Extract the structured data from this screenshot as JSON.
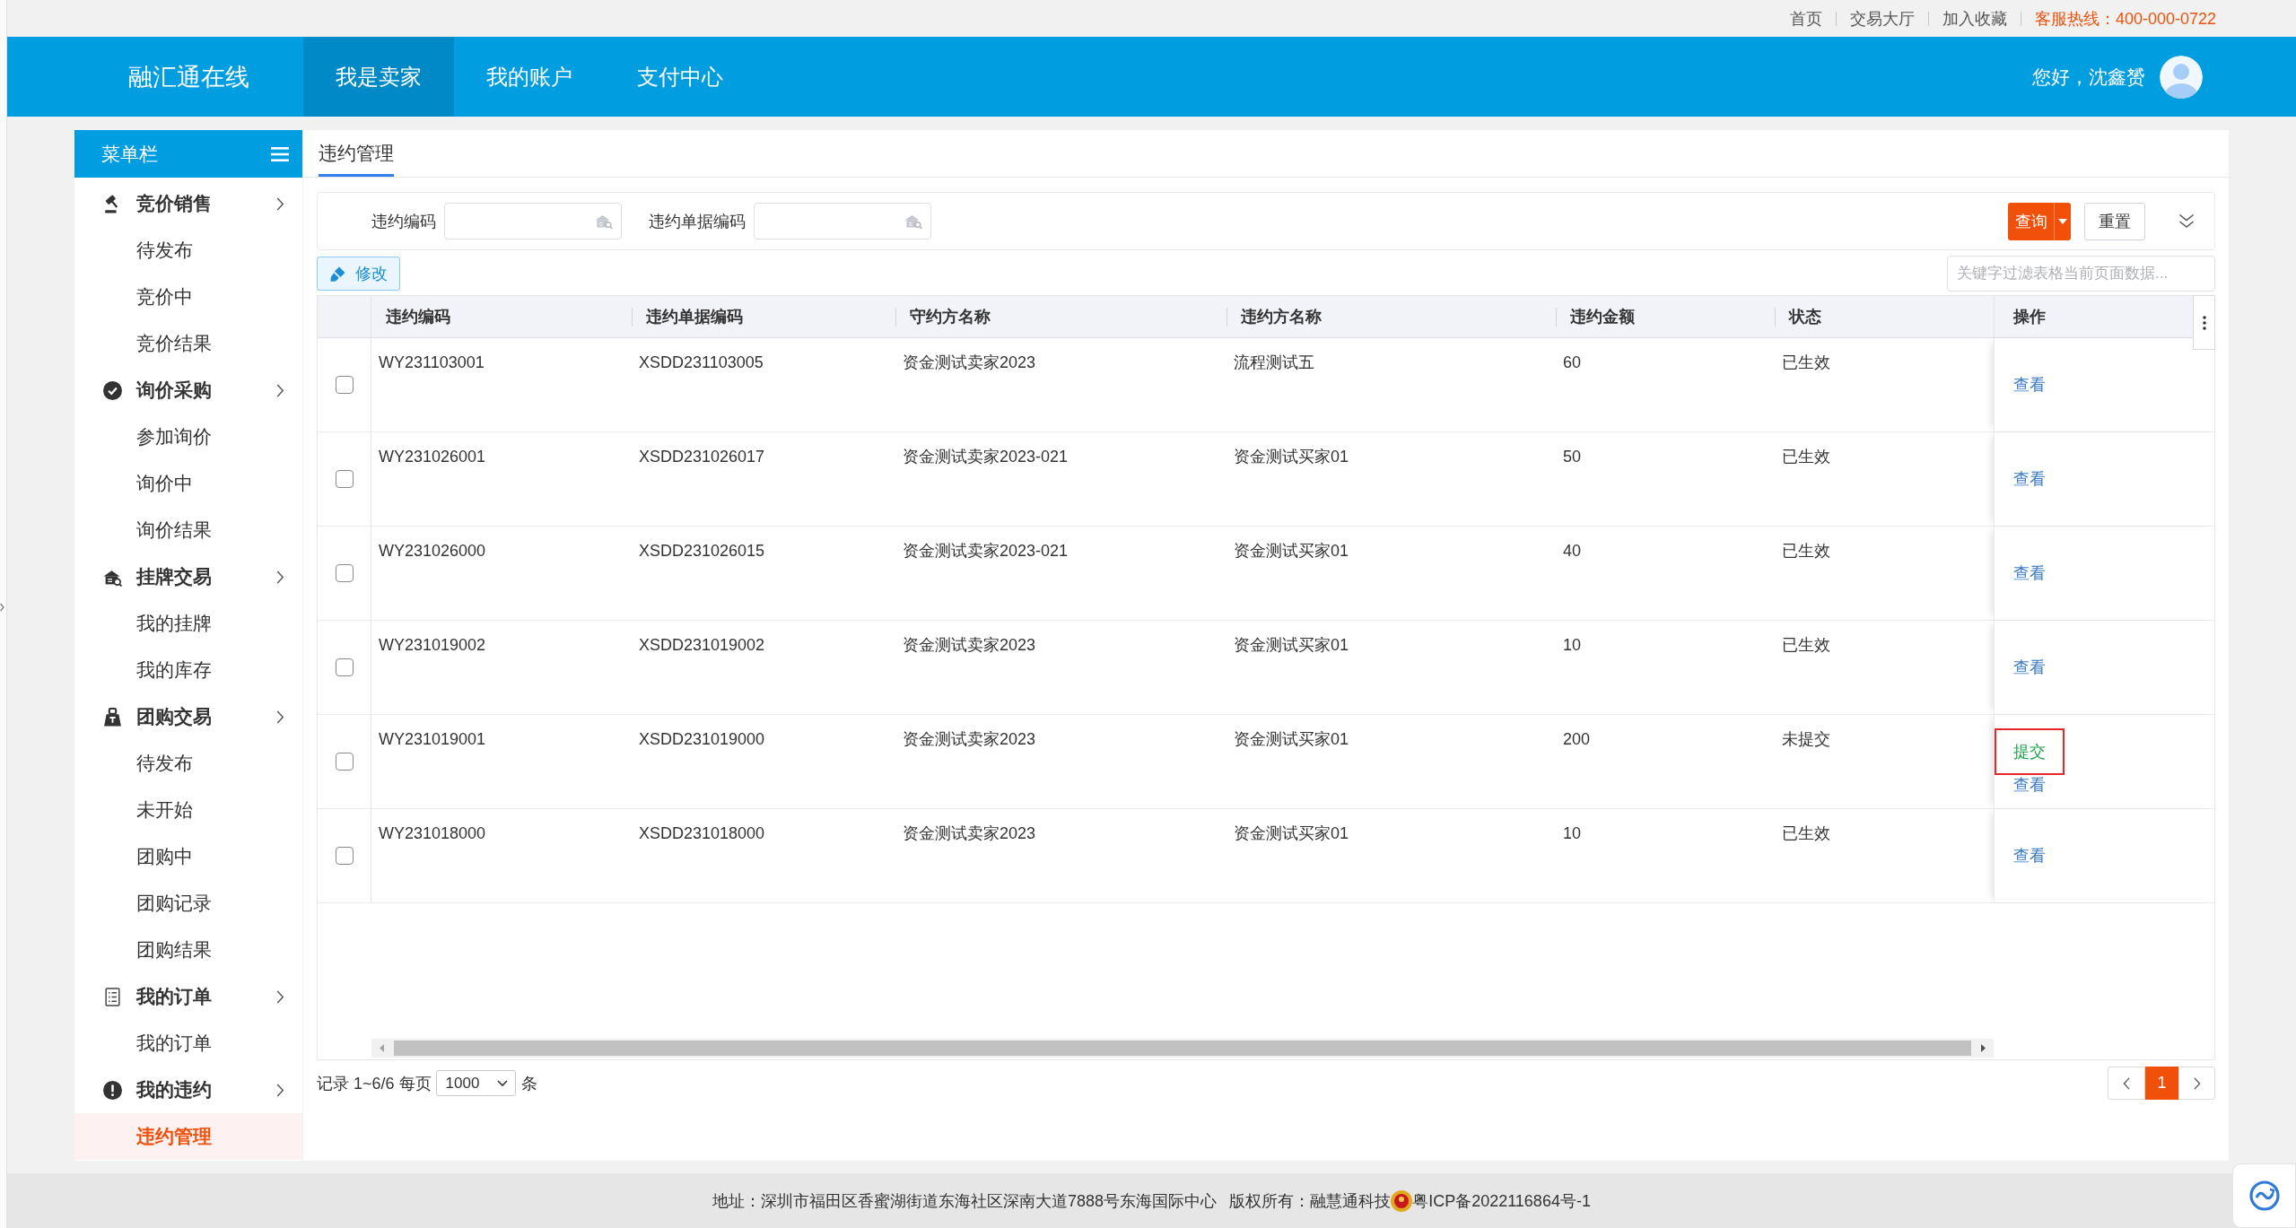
{
  "top_bar": {
    "links": [
      {
        "label": "首页"
      },
      {
        "label": "交易大厅"
      },
      {
        "label": "加入收藏"
      }
    ],
    "hotline": "客服热线：400-000-0722"
  },
  "header": {
    "logo": "融汇通在线",
    "nav": [
      {
        "label": "我是卖家",
        "selected": true
      },
      {
        "label": "我的账户",
        "selected": false
      },
      {
        "label": "支付中心",
        "selected": false
      }
    ],
    "greeting": "您好，沈鑫赟"
  },
  "sidebar": {
    "title": "菜单栏",
    "groups": [
      {
        "label": "竞价销售",
        "children": [
          {
            "label": "待发布",
            "selected": false
          },
          {
            "label": "竞价中",
            "selected": false
          },
          {
            "label": "竞价结果",
            "selected": false
          }
        ]
      },
      {
        "label": "询价采购",
        "children": [
          {
            "label": "参加询价",
            "selected": false
          },
          {
            "label": "询价中",
            "selected": false
          },
          {
            "label": "询价结果",
            "selected": false
          }
        ]
      },
      {
        "label": "挂牌交易",
        "children": [
          {
            "label": "我的挂牌",
            "selected": false
          },
          {
            "label": "我的库存",
            "selected": false
          }
        ]
      },
      {
        "label": "团购交易",
        "children": [
          {
            "label": "待发布",
            "selected": false
          },
          {
            "label": "未开始",
            "selected": false
          },
          {
            "label": "团购中",
            "selected": false
          },
          {
            "label": "团购记录",
            "selected": false
          },
          {
            "label": "团购结果",
            "selected": false
          }
        ]
      },
      {
        "label": "我的订单",
        "children": [
          {
            "label": "我的订单",
            "selected": false
          }
        ]
      },
      {
        "label": "我的违约",
        "children": [
          {
            "label": "违约管理",
            "selected": true
          }
        ]
      }
    ]
  },
  "tabs": [
    {
      "label": "违约管理",
      "selected": true
    }
  ],
  "filter": {
    "fields": [
      {
        "label": "违约编码"
      },
      {
        "label": "违约单据编码"
      }
    ],
    "query_button": "查询",
    "reset_button": "重置"
  },
  "toolbar": {
    "edit_button": "修改",
    "keyword_filter": {
      "placeholder": "关键字过滤表格当前页面数据..."
    }
  },
  "table": {
    "columns": [
      "违约编码",
      "违约单据编码",
      "守约方名称",
      "违约方名称",
      "违约金额",
      "状态",
      "操作"
    ],
    "rows": [
      {
        "checked": false,
        "cells": [
          "WY231103001",
          "XSDD231103005",
          "资金测试卖家2023",
          "流程测试五",
          "60",
          "已生效"
        ],
        "actions": [
          {
            "label": "查看",
            "kind": "view",
            "highlighted": false
          }
        ]
      },
      {
        "checked": false,
        "cells": [
          "WY231026001",
          "XSDD231026017",
          "资金测试卖家2023-021",
          "资金测试买家01",
          "50",
          "已生效"
        ],
        "actions": [
          {
            "label": "查看",
            "kind": "view",
            "highlighted": false
          }
        ]
      },
      {
        "checked": false,
        "cells": [
          "WY231026000",
          "XSDD231026015",
          "资金测试卖家2023-021",
          "资金测试买家01",
          "40",
          "已生效"
        ],
        "actions": [
          {
            "label": "查看",
            "kind": "view",
            "highlighted": false
          }
        ]
      },
      {
        "checked": false,
        "cells": [
          "WY231019002",
          "XSDD231019002",
          "资金测试卖家2023",
          "资金测试买家01",
          "10",
          "已生效"
        ],
        "actions": [
          {
            "label": "查看",
            "kind": "view",
            "highlighted": false
          }
        ]
      },
      {
        "checked": false,
        "cells": [
          "WY231019001",
          "XSDD231019000",
          "资金测试卖家2023",
          "资金测试买家01",
          "200",
          "未提交"
        ],
        "actions": [
          {
            "label": "提交",
            "kind": "submit",
            "highlighted": true
          },
          {
            "label": "查看",
            "kind": "view",
            "highlighted": false
          }
        ]
      },
      {
        "checked": false,
        "cells": [
          "WY231018000",
          "XSDD231018000",
          "资金测试卖家2023",
          "资金测试买家01",
          "10",
          "已生效"
        ],
        "actions": [
          {
            "label": "查看",
            "kind": "view",
            "highlighted": false
          }
        ]
      }
    ]
  },
  "pagination": {
    "summary": "记录 1~6/6 每页",
    "page_size": "1000",
    "unit": "条",
    "pages": [
      {
        "label": "1",
        "selected": true
      }
    ]
  },
  "footer": {
    "address": "地址：深圳市福田区香蜜湖街道东海社区深南大道7888号东海国际中心",
    "copyright": "版权所有：融慧通科技",
    "icp": "粤ICP备2022116864号-1"
  }
}
